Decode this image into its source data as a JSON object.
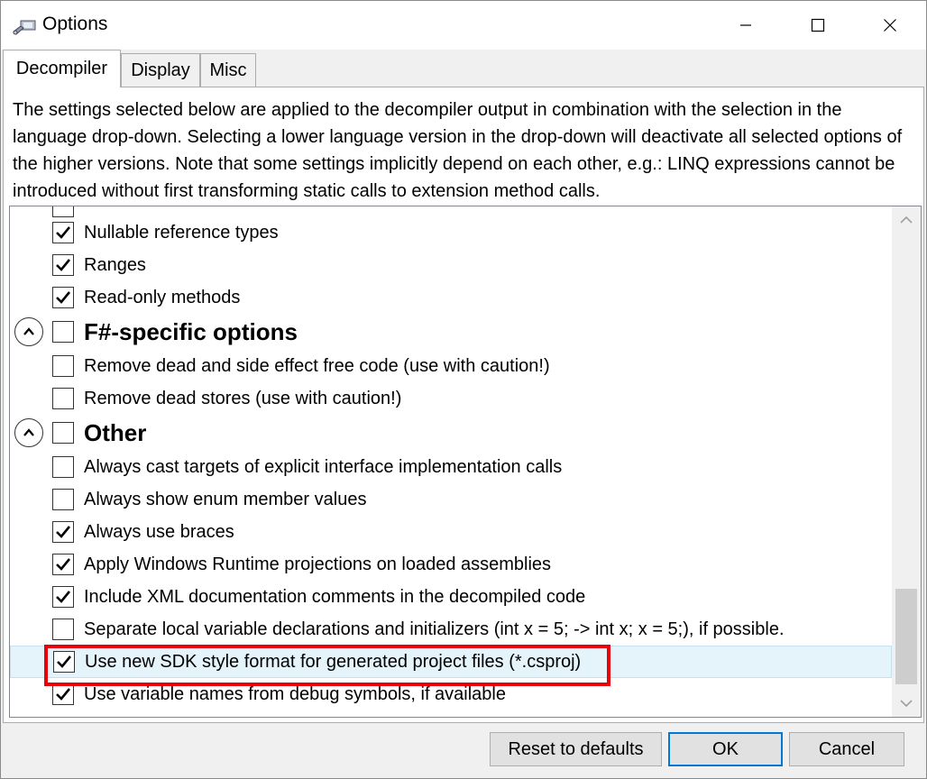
{
  "window": {
    "title": "Options",
    "icon": "options-app-icon",
    "controls": {
      "minimize": "minimize-icon",
      "maximize": "maximize-icon",
      "close": "close-icon"
    }
  },
  "tabs": [
    {
      "label": "Decompiler",
      "active": true
    },
    {
      "label": "Display",
      "active": false
    },
    {
      "label": "Misc",
      "active": false
    }
  ],
  "description": "The settings selected below are applied to the decompiler output in combination with the selection in the language drop-down. Selecting a lower language version in the drop-down will deactivate all selected options of the higher versions. Note that some settings implicitly depend on each other, e.g.: LINQ expressions cannot be introduced without first transforming static calls to extension method calls.",
  "options": {
    "top_items": [
      {
        "label": "Nullable reference types",
        "checked": true
      },
      {
        "label": "Ranges",
        "checked": true
      },
      {
        "label": "Read-only methods",
        "checked": true
      }
    ],
    "fsharp_group": {
      "title": "F#-specific options",
      "checked": false,
      "items": [
        {
          "label": "Remove dead and side effect free code (use with caution!)",
          "checked": false
        },
        {
          "label": "Remove dead stores (use with caution!)",
          "checked": false
        }
      ]
    },
    "other_group": {
      "title": "Other",
      "checked": false,
      "items": [
        {
          "label": "Always cast targets of explicit interface implementation calls",
          "checked": false
        },
        {
          "label": "Always show enum member values",
          "checked": false
        },
        {
          "label": "Always use braces",
          "checked": true
        },
        {
          "label": "Apply Windows Runtime projections on loaded assemblies",
          "checked": true
        },
        {
          "label": "Include XML documentation comments in the decompiled code",
          "checked": true
        },
        {
          "label": "Separate local variable declarations and initializers (int x = 5; -> int x; x = 5;), if possible.",
          "checked": false
        },
        {
          "label": "Use new SDK style format for generated project files (*.csproj)",
          "checked": true,
          "selected": true
        },
        {
          "label": "Use variable names from debug symbols, if available",
          "checked": true
        }
      ]
    }
  },
  "buttons": {
    "reset": "Reset to defaults",
    "ok": "OK",
    "cancel": "Cancel"
  },
  "highlight_color": "#e8000b",
  "selection_color": "#e5f3fb"
}
